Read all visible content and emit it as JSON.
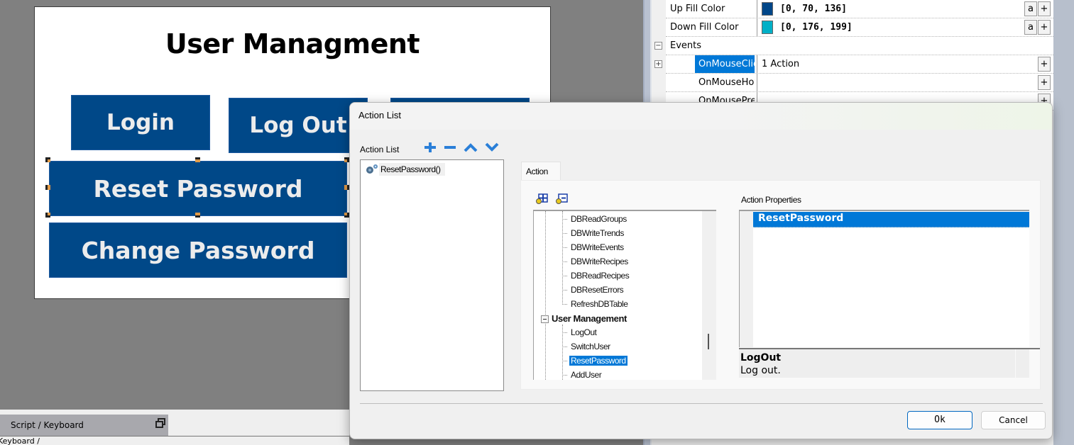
{
  "canvas": {
    "title": "User Managment",
    "buttons": {
      "login": "Login",
      "logout": "Log Out",
      "reset_password": "Reset Password",
      "change_password": "Change Password"
    },
    "button_color": "#004888"
  },
  "properties": {
    "rows": [
      {
        "name": "Up Fill Color",
        "value": "[0, 70, 136]",
        "swatch": "#004688"
      },
      {
        "name": "Down Fill Color",
        "value": "[0, 176, 199]",
        "swatch": "#00B0C7"
      },
      {
        "name": "Events",
        "value": ""
      },
      {
        "name": "OnMouseClick",
        "value": "1 Action"
      },
      {
        "name": "OnMouseHover",
        "value": ""
      },
      {
        "name": "OnMousePress",
        "value": ""
      }
    ],
    "a_label": "a",
    "plus_label": "+"
  },
  "bottom_panel": {
    "tab_label": "Script / Keyboard",
    "sub_tab_label": "Keyboard"
  },
  "dialog": {
    "title": "Action List",
    "action_list_label": "Action List",
    "actions": [
      "ResetPassword()"
    ],
    "tab_label": "Action",
    "tree": {
      "items": [
        "DBReadGroups",
        "DBWriteTrends",
        "DBWriteEvents",
        "DBWriteRecipes",
        "DBReadRecipes",
        "DBResetErrors",
        "RefreshDBTable"
      ],
      "group": "User Management",
      "group_items": [
        "LogOut",
        "SwitchUser",
        "ResetPassword",
        "AddUser"
      ],
      "selected": "ResetPassword"
    },
    "action_properties_label": "Action Properties",
    "action_properties_selected": "ResetPassword",
    "description_title": "LogOut",
    "description_text": "Log out.",
    "ok_label": "Ok",
    "cancel_label": "Cancel",
    "accent_color": "#0078D7"
  }
}
